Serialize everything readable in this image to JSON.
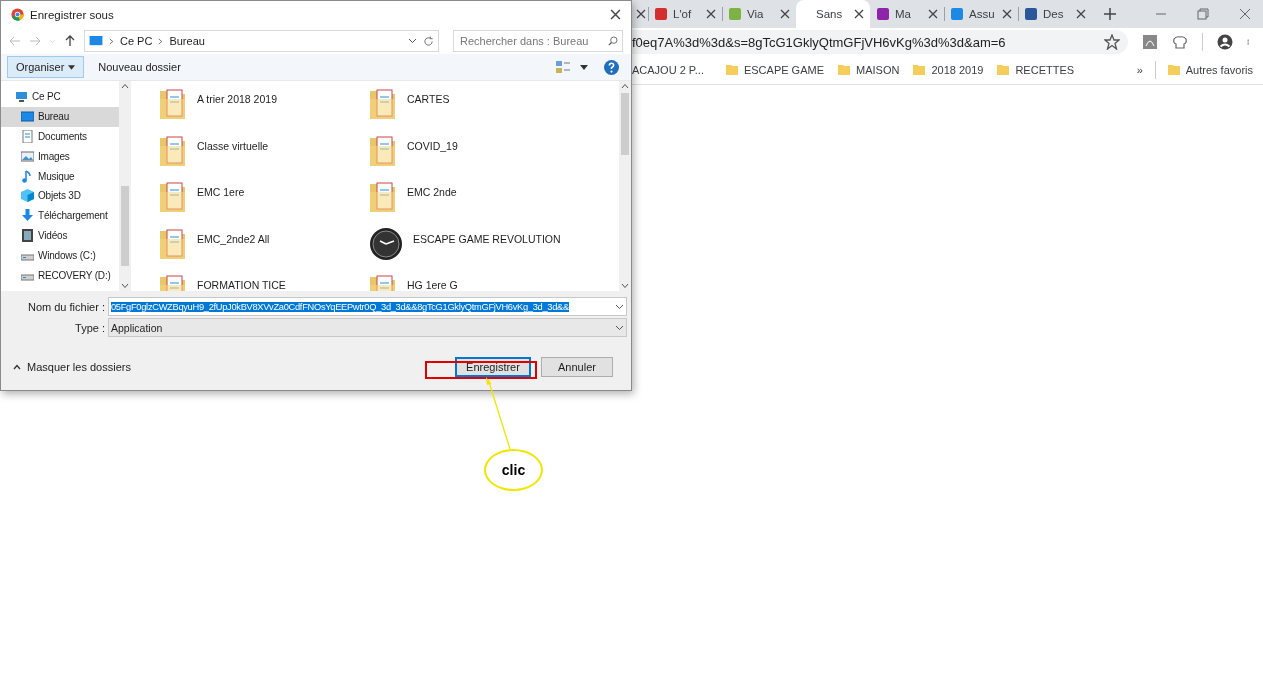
{
  "browser": {
    "tabs": [
      {
        "selected": false
      },
      {
        "title": "L'of",
        "selected": false,
        "color": "#d32f2f"
      },
      {
        "title": "Via",
        "selected": false,
        "color": "#7cb342"
      },
      {
        "title": "Sans",
        "selected": true
      },
      {
        "title": "Ma",
        "selected": false,
        "color": "#8e24aa"
      },
      {
        "title": "Assu",
        "selected": false,
        "color": "#1e88e5"
      },
      {
        "title": "Des",
        "selected": false,
        "color": "#2b579a"
      }
    ],
    "address": "f0eq7A%3d%3d&s=8gTcG1GklyQtmGFjVH6vKg%3d%3d&am=6",
    "bookmarks": [
      {
        "label": "ACAJOU 2 P...",
        "kind": "link"
      },
      {
        "label": "ESCAPE GAME",
        "kind": "folder"
      },
      {
        "label": "MAISON",
        "kind": "folder"
      },
      {
        "label": "2018 2019",
        "kind": "folder"
      },
      {
        "label": "RECETTES",
        "kind": "folder"
      }
    ],
    "overflow": "»",
    "other_bookmarks": "Autres favoris"
  },
  "dialog": {
    "title": "Enregistrer sous",
    "breadcrumb": [
      "Ce PC",
      "Bureau"
    ],
    "search": {
      "placeholder": "Rechercher dans : Bureau"
    },
    "toolbar": {
      "organize": "Organiser",
      "new_folder": "Nouveau dossier"
    },
    "sidebar": {
      "items": [
        {
          "label": "Ce PC",
          "kind": "pc",
          "selected": false,
          "children": [
            {
              "label": "Bureau",
              "kind": "desktop",
              "selected": true
            },
            {
              "label": "Documents",
              "kind": "documents",
              "selected": false
            },
            {
              "label": "Images",
              "kind": "images",
              "selected": false
            },
            {
              "label": "Musique",
              "kind": "music",
              "selected": false
            },
            {
              "label": "Objets 3D",
              "kind": "objects3d",
              "selected": false
            },
            {
              "label": "Téléchargement",
              "kind": "downloads",
              "selected": false
            },
            {
              "label": "Vidéos",
              "kind": "videos",
              "selected": false
            },
            {
              "label": "Windows (C:)",
              "kind": "drive",
              "selected": false
            },
            {
              "label": "RECOVERY (D:)",
              "kind": "drive",
              "selected": false
            }
          ]
        }
      ]
    },
    "files": [
      {
        "name": "A trier 2018 2019",
        "kind": "folder"
      },
      {
        "name": "CARTES",
        "kind": "folder"
      },
      {
        "name": "Classe virtuelle",
        "kind": "folder"
      },
      {
        "name": "COVID_19",
        "kind": "folder"
      },
      {
        "name": "EMC 1ere",
        "kind": "folder"
      },
      {
        "name": "EMC 2nde",
        "kind": "folder"
      },
      {
        "name": "EMC_2nde2 All",
        "kind": "folder"
      },
      {
        "name": "ESCAPE GAME REVOLUTION",
        "kind": "app"
      },
      {
        "name": "FORMATION TICE",
        "kind": "folder"
      },
      {
        "name": "HG 1ere G",
        "kind": "folder"
      }
    ],
    "file_name": {
      "label": "Nom du fichier :",
      "value": "05FgF0glzCWZBqyuH9_2fUpJ0kBV8XVvZa0CdfFNOsYqEEPwtr0Q_3d_3d&&8gTcG1GklyQtmGFjVH6vKg_3d_3d&&",
      "selected": true
    },
    "file_type": {
      "label": "Type :",
      "value": "Application"
    },
    "hide_folders": "Masquer les dossiers",
    "buttons": [
      {
        "label": "Enregistrer",
        "default": true
      },
      {
        "label": "Annuler",
        "default": false
      }
    ]
  },
  "annotation": {
    "label": "clic"
  }
}
